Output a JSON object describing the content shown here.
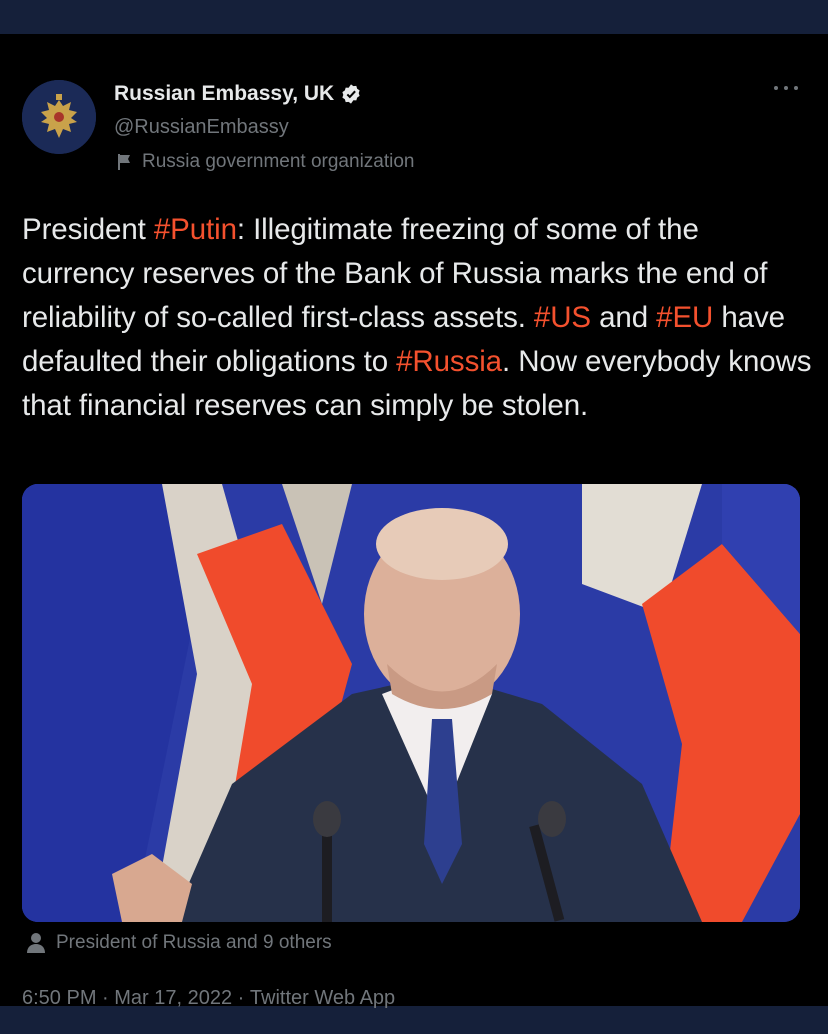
{
  "account": {
    "name": "Russian Embassy, UK",
    "handle": "@RussianEmbassy",
    "label": "Russia government organization",
    "avatar_icon": "double-headed-eagle-emblem",
    "verified_icon": "verified-badge-icon"
  },
  "tweet": {
    "segments": [
      {
        "text": "President ",
        "tag": false
      },
      {
        "text": "#Putin",
        "tag": true
      },
      {
        "text": ": Illegitimate freezing of some of the currency reserves of the Bank of Russia marks the end of reliability of so-called first-class assets. ",
        "tag": false
      },
      {
        "text": "#US",
        "tag": true
      },
      {
        "text": " and ",
        "tag": false
      },
      {
        "text": "#EU",
        "tag": true
      },
      {
        "text": " have defaulted their obligations to ",
        "tag": false
      },
      {
        "text": "#Russia",
        "tag": true
      },
      {
        "text": ". Now everybody knows that financial reserves can simply be stolen.",
        "tag": false
      }
    ]
  },
  "media": {
    "tagged_people": "President of Russia and 9 others"
  },
  "meta": {
    "time": "6:50 PM",
    "separator": " · ",
    "date": "Mar 17, 2022",
    "source": "Twitter Web App"
  },
  "colors": {
    "background": "#000000",
    "outer": "#15203a",
    "hashtag": "#f4512e",
    "secondary_text": "#71767b",
    "primary_text": "#e7e9ea"
  }
}
